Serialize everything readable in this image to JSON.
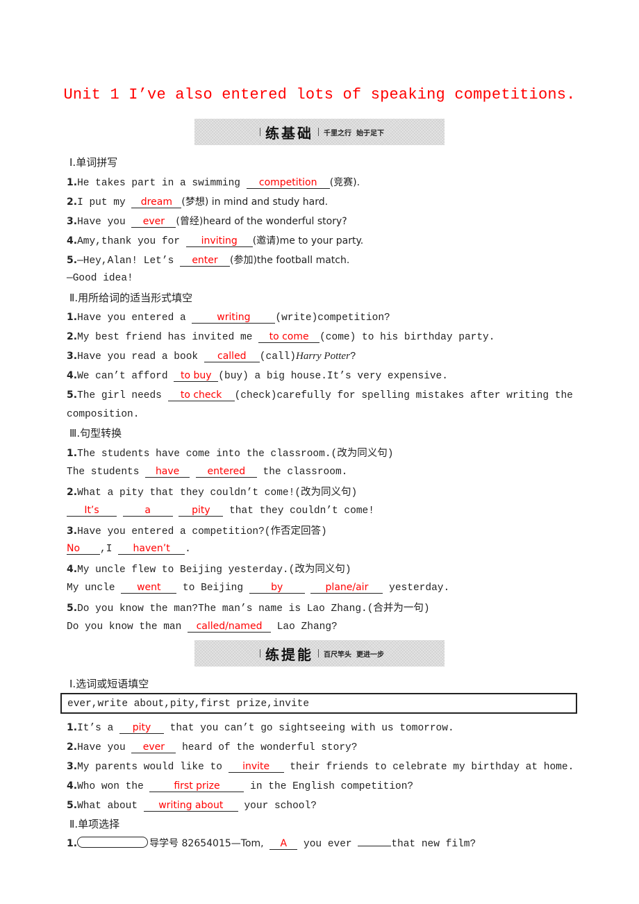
{
  "title": "Unit 1  I’ve also entered lots of speaking competitions.",
  "banners": [
    {
      "main": "练基础",
      "sub": "千里之行  始于足下"
    },
    {
      "main": "练提能",
      "sub": "百尺竿头  更进一步"
    }
  ],
  "part1": {
    "heading": "Ⅰ.单词拼写",
    "items": [
      {
        "num": "1.",
        "before": "He takes part in a swimming ",
        "answer": "competition",
        "after": "(竞赛)."
      },
      {
        "num": "2.",
        "before": "I put my ",
        "answer": "dream",
        "after": "(梦想) in mind and study hard."
      },
      {
        "num": "3.",
        "before": "Have you ",
        "answer": "ever",
        "after": "(曾经)heard of the wonderful story?"
      },
      {
        "num": "4.",
        "before": "Amy,thank you for ",
        "answer": "inviting",
        "after": "(邀请)me to your party."
      },
      {
        "num": "5.",
        "before": "—Hey,Alan! Let’s ",
        "answer": "enter",
        "after": "(参加)the football match."
      }
    ],
    "reply": "—Good idea!"
  },
  "part2": {
    "heading": "Ⅱ.用所给词的适当形式填空",
    "items": [
      {
        "num": "1.",
        "before": "Have you entered a ",
        "answer": "writing",
        "after": "(write)competition?"
      },
      {
        "num": "2.",
        "before": "My best friend has invited me ",
        "answer": "to come",
        "after": "(come) to his birthday party."
      },
      {
        "num": "3.",
        "before": "Have you read a book ",
        "answer": "called",
        "after": "(call)",
        "italic": "Harry Potter",
        "tail": "?"
      },
      {
        "num": "4.",
        "before": "We can’t afford ",
        "answer": "to buy",
        "after": "(buy) a big house.It’s very expensive."
      },
      {
        "num": "5.",
        "before": "The girl needs ",
        "answer": "to check",
        "after": "(check)carefully for spelling mistakes after writing the"
      }
    ],
    "continuation": "composition."
  },
  "part3": {
    "heading": "Ⅲ.句型转换",
    "q1": {
      "num": "1.",
      "text": "The students have come into the classroom.(改为同义句)",
      "prefix": "The students ",
      "answers": [
        "have",
        "entered"
      ],
      "suffix": " the classroom."
    },
    "q2": {
      "num": "2.",
      "text": "What a pity that they couldn’t come!(改为同义句)",
      "answers": [
        "It’s",
        "a",
        "pity"
      ],
      "suffix": " that they couldn’t come!"
    },
    "q3": {
      "num": "3.",
      "text": "Have you entered a competition?(作否定回答)",
      "answers": [
        "No",
        "haven’t"
      ],
      "mid": ",I ",
      "suffix": "."
    },
    "q4": {
      "num": "4.",
      "text": "My uncle flew to Beijing yesterday.(改为同义句)",
      "prefix": "My uncle ",
      "answers": [
        "went",
        "by",
        "plane/air"
      ],
      "mid": " to Beijing ",
      "suffix": " yesterday."
    },
    "q5": {
      "num": "5.",
      "text": "Do you know the man?The man’s name is Lao Zhang.(合并为一句)",
      "prefix": "Do you know the man ",
      "answers": [
        "called/named"
      ],
      "suffix": " Lao Zhang?"
    }
  },
  "part4": {
    "heading": "Ⅰ.选词或短语填空",
    "wordbox": "ever,write about,pity,first prize,invite",
    "items": [
      {
        "num": "1.",
        "before": "It’s a ",
        "answer": "pity",
        "after": " that you can’t go sightseeing with us tomorrow."
      },
      {
        "num": "2.",
        "before": "Have you ",
        "answer": "ever",
        "after": " heard of the wonderful story?"
      },
      {
        "num": "3.",
        "before": "My parents would like to ",
        "answer": "invite",
        "after": " their friends to celebrate my birthday at home."
      },
      {
        "num": "4.",
        "before": "Who won the ",
        "answer": "first prize",
        "after": " in the English competition?"
      },
      {
        "num": "5.",
        "before": "What about ",
        "answer": "writing about",
        "after": " your school?"
      }
    ]
  },
  "part5": {
    "heading": "Ⅱ.单项选择",
    "q1": {
      "num": "1.",
      "guide": "导学号 82654015—Tom,",
      "answer": "A",
      "mid": " you ever ",
      "suffix": "that new film?"
    }
  }
}
